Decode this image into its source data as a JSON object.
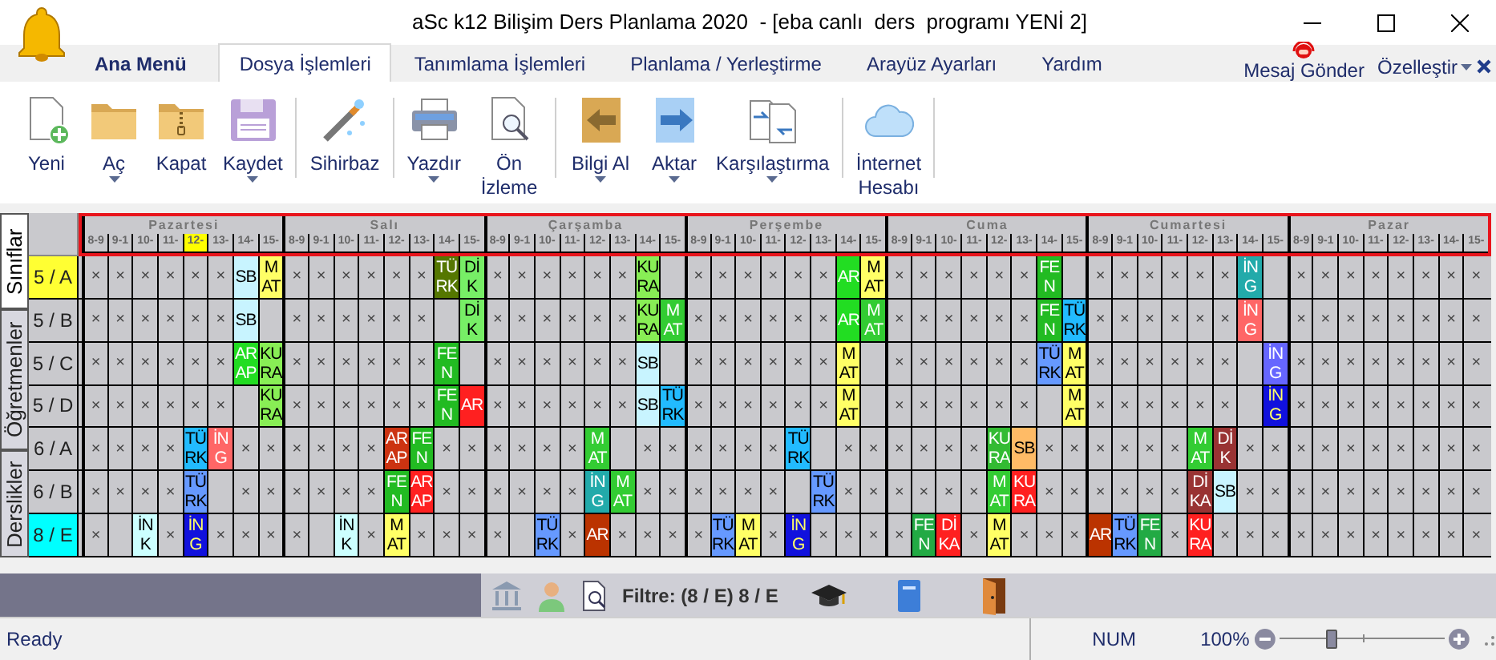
{
  "window": {
    "title": "aSc k12 Bilişim Ders Planlama 2020  - [eba canlı  ders  programı YENİ 2]"
  },
  "ribbon_tabs": [
    {
      "label": "Ana Menü",
      "kind": "app_menu",
      "selected": false
    },
    {
      "label": "Dosya İşlemleri",
      "kind": "tab",
      "selected": true
    },
    {
      "label": "Tanımlama İşlemleri",
      "kind": "tab",
      "selected": false
    },
    {
      "label": "Planlama / Yerleştirme",
      "kind": "tab",
      "selected": false
    },
    {
      "label": "Arayüz Ayarları",
      "kind": "tab",
      "selected": false
    },
    {
      "label": "Yardım",
      "kind": "tab",
      "selected": false
    }
  ],
  "message_button": {
    "label": "Mesaj Gönder"
  },
  "customize_button": {
    "label": "Özelleştir",
    "has_menu": true
  },
  "ribbon_groups": [
    [
      {
        "label": "Yeni",
        "has_menu": false
      },
      {
        "label": "Aç",
        "has_menu": true
      },
      {
        "label": "Kapat",
        "has_menu": false
      },
      {
        "label": "Kaydet",
        "has_menu": true
      }
    ],
    [
      {
        "label": "Sihirbaz",
        "has_menu": false
      }
    ],
    [
      {
        "label": "Yazdır",
        "has_menu": true
      },
      {
        "label": "Ön İzleme",
        "has_menu": false
      }
    ],
    [
      {
        "label": "Bilgi Al",
        "has_menu": true
      },
      {
        "label": "Aktar",
        "has_menu": true
      },
      {
        "label": "Karşılaştırma",
        "has_menu": true
      }
    ],
    [
      {
        "label": "İnternet Hesabı",
        "has_menu": false
      }
    ]
  ],
  "view_tabs": [
    {
      "label": "Sınıflar",
      "selected": true
    },
    {
      "label": "Öğretmenler",
      "selected": false
    },
    {
      "label": "Derslikler",
      "selected": false
    }
  ],
  "timetable": {
    "days": [
      {
        "name": "Pazartesi",
        "hours": [
          {
            "label": "8-9",
            "selected": false
          },
          {
            "label": "9-1",
            "selected": false
          },
          {
            "label": "10-",
            "selected": false
          },
          {
            "label": "11-",
            "selected": false
          },
          {
            "label": "12-",
            "selected": true
          },
          {
            "label": "13-",
            "selected": false
          },
          {
            "label": "14-",
            "selected": false
          },
          {
            "label": "15-",
            "selected": false
          }
        ]
      },
      {
        "name": "Salı",
        "hours": [
          {
            "label": "8-9",
            "selected": false
          },
          {
            "label": "9-1",
            "selected": false
          },
          {
            "label": "10-",
            "selected": false
          },
          {
            "label": "11-",
            "selected": false
          },
          {
            "label": "12-",
            "selected": false
          },
          {
            "label": "13-",
            "selected": false
          },
          {
            "label": "14-",
            "selected": false
          },
          {
            "label": "15-",
            "selected": false
          }
        ]
      },
      {
        "name": "Çarşamba",
        "hours": [
          {
            "label": "8-9",
            "selected": false
          },
          {
            "label": "9-1",
            "selected": false
          },
          {
            "label": "10-",
            "selected": false
          },
          {
            "label": "11-",
            "selected": false
          },
          {
            "label": "12-",
            "selected": false
          },
          {
            "label": "13-",
            "selected": false
          },
          {
            "label": "14-",
            "selected": false
          },
          {
            "label": "15-",
            "selected": false
          }
        ]
      },
      {
        "name": "Perşembe",
        "hours": [
          {
            "label": "8-9",
            "selected": false
          },
          {
            "label": "9-1",
            "selected": false
          },
          {
            "label": "10-",
            "selected": false
          },
          {
            "label": "11-",
            "selected": false
          },
          {
            "label": "12-",
            "selected": false
          },
          {
            "label": "13-",
            "selected": false
          },
          {
            "label": "14-",
            "selected": false
          },
          {
            "label": "15-",
            "selected": false
          }
        ]
      },
      {
        "name": "Cuma",
        "hours": [
          {
            "label": "8-9",
            "selected": false
          },
          {
            "label": "9-1",
            "selected": false
          },
          {
            "label": "10-",
            "selected": false
          },
          {
            "label": "11-",
            "selected": false
          },
          {
            "label": "12-",
            "selected": false
          },
          {
            "label": "13-",
            "selected": false
          },
          {
            "label": "14-",
            "selected": false
          },
          {
            "label": "15-",
            "selected": false
          }
        ]
      },
      {
        "name": "Cumartesi",
        "hours": [
          {
            "label": "8-9",
            "selected": false
          },
          {
            "label": "9-1",
            "selected": false
          },
          {
            "label": "10-",
            "selected": false
          },
          {
            "label": "11-",
            "selected": false
          },
          {
            "label": "12-",
            "selected": false
          },
          {
            "label": "13-",
            "selected": false
          },
          {
            "label": "14-",
            "selected": false
          },
          {
            "label": "15-",
            "selected": false
          }
        ]
      },
      {
        "name": "Pazar",
        "hours": [
          {
            "label": "8-9",
            "selected": false
          },
          {
            "label": "9-1",
            "selected": false
          },
          {
            "label": "10-",
            "selected": false
          },
          {
            "label": "11-",
            "selected": false
          },
          {
            "label": "12-",
            "selected": false
          },
          {
            "label": "13-",
            "selected": false
          },
          {
            "label": "14-",
            "selected": false
          },
          {
            "label": "15-",
            "selected": false
          }
        ]
      }
    ],
    "rows": [
      {
        "label": "5 / A",
        "color": "#ffff33",
        "days": [
          [
            "×",
            "×",
            "×",
            "×",
            "×",
            "×",
            {
              "kind": "lesson",
              "text": "SB",
              "color": "#c8f4ff"
            },
            {
              "kind": "lesson",
              "text": "MAT",
              "color": "#ffff66"
            }
          ],
          [
            "×",
            "×",
            "×",
            "×",
            "×",
            "×",
            {
              "kind": "lesson",
              "text": "TÜRK",
              "color": "#557700"
            },
            {
              "kind": "lesson",
              "text": "DİK",
              "color": "#77ee66"
            }
          ],
          [
            "×",
            "×",
            "×",
            "×",
            "×",
            "×",
            {
              "kind": "lesson",
              "text": "KURA",
              "color": "#88ee55"
            },
            {
              "kind": "free"
            }
          ],
          [
            "×",
            "×",
            "×",
            "×",
            "×",
            "×",
            {
              "kind": "lesson",
              "text": "AR",
              "color": "#22dd22"
            },
            {
              "kind": "lesson",
              "text": "MAT",
              "color": "#ffff66"
            }
          ],
          [
            "×",
            "×",
            "×",
            "×",
            "×",
            "×",
            {
              "kind": "lesson",
              "text": "FEN",
              "color": "#22bb22"
            },
            {
              "kind": "free"
            }
          ],
          [
            "×",
            "×",
            "×",
            "×",
            "×",
            "×",
            {
              "kind": "lesson",
              "text": "İNG",
              "color": "#22aaaa"
            },
            {
              "kind": "free"
            }
          ],
          [
            "×",
            "×",
            "×",
            "×",
            "×",
            "×",
            "×",
            "×"
          ]
        ]
      },
      {
        "label": "5 / B",
        "days": [
          [
            "×",
            "×",
            "×",
            "×",
            "×",
            "×",
            {
              "kind": "lesson",
              "text": "SB",
              "color": "#c8f4ff"
            },
            {
              "kind": "free"
            }
          ],
          [
            "×",
            "×",
            "×",
            "×",
            "×",
            "×",
            {
              "kind": "free"
            },
            {
              "kind": "lesson",
              "text": "DİK",
              "color": "#77ee66"
            }
          ],
          [
            "×",
            "×",
            "×",
            "×",
            "×",
            "×",
            {
              "kind": "lesson",
              "text": "KURA",
              "color": "#88ee55"
            },
            {
              "kind": "lesson",
              "text": "MAT",
              "color": "#33cc33"
            }
          ],
          [
            "×",
            "×",
            "×",
            "×",
            "×",
            "×",
            {
              "kind": "lesson",
              "text": "AR",
              "color": "#22dd22"
            },
            {
              "kind": "lesson",
              "text": "MAT",
              "color": "#33cc33"
            }
          ],
          [
            "×",
            "×",
            "×",
            "×",
            "×",
            "×",
            {
              "kind": "lesson",
              "text": "FEN",
              "color": "#22bb22"
            },
            {
              "kind": "lesson",
              "text": "TÜRK",
              "color": "#22bbff"
            }
          ],
          [
            "×",
            "×",
            "×",
            "×",
            "×",
            "×",
            {
              "kind": "lesson",
              "text": "İNG",
              "color": "#ff6666"
            },
            {
              "kind": "free"
            }
          ],
          [
            "×",
            "×",
            "×",
            "×",
            "×",
            "×",
            "×",
            "×"
          ]
        ]
      },
      {
        "label": "5 / C",
        "days": [
          [
            "×",
            "×",
            "×",
            "×",
            "×",
            "×",
            {
              "kind": "lesson",
              "text": "ARAP",
              "color": "#22dd22"
            },
            {
              "kind": "lesson",
              "text": "KURA",
              "color": "#88ee55"
            }
          ],
          [
            "×",
            "×",
            "×",
            "×",
            "×",
            "×",
            {
              "kind": "lesson",
              "text": "FEN",
              "color": "#22bb22"
            },
            {
              "kind": "free"
            }
          ],
          [
            "×",
            "×",
            "×",
            "×",
            "×",
            "×",
            {
              "kind": "lesson",
              "text": "SB",
              "color": "#c8f4ff"
            },
            {
              "kind": "free"
            }
          ],
          [
            "×",
            "×",
            "×",
            "×",
            "×",
            "×",
            {
              "kind": "lesson",
              "text": "MAT",
              "color": "#ffff66"
            },
            {
              "kind": "free"
            }
          ],
          [
            "×",
            "×",
            "×",
            "×",
            "×",
            "×",
            {
              "kind": "lesson",
              "text": "TÜRK",
              "color": "#6699ff"
            },
            {
              "kind": "lesson",
              "text": "MAT",
              "color": "#ffff66"
            }
          ],
          [
            "×",
            "×",
            "×",
            "×",
            "×",
            "×",
            {
              "kind": "free"
            },
            {
              "kind": "lesson",
              "text": "İNG",
              "color": "#6666ff"
            }
          ],
          [
            "×",
            "×",
            "×",
            "×",
            "×",
            "×",
            "×",
            "×"
          ]
        ]
      },
      {
        "label": "5 / D",
        "days": [
          [
            "×",
            "×",
            "×",
            "×",
            "×",
            "×",
            {
              "kind": "free"
            },
            {
              "kind": "lesson",
              "text": "KURA",
              "color": "#88ee55"
            }
          ],
          [
            "×",
            "×",
            "×",
            "×",
            "×",
            "×",
            {
              "kind": "lesson",
              "text": "FEN",
              "color": "#22bb22"
            },
            {
              "kind": "lesson",
              "text": "AR",
              "color": "#ff2020"
            }
          ],
          [
            "×",
            "×",
            "×",
            "×",
            "×",
            "×",
            {
              "kind": "lesson",
              "text": "SB",
              "color": "#c8f4ff"
            },
            {
              "kind": "lesson",
              "text": "TÜRK",
              "color": "#22bbff"
            }
          ],
          [
            "×",
            "×",
            "×",
            "×",
            "×",
            "×",
            {
              "kind": "lesson",
              "text": "MAT",
              "color": "#ffff66"
            },
            {
              "kind": "free"
            }
          ],
          [
            "×",
            "×",
            "×",
            "×",
            "×",
            "×",
            {
              "kind": "free"
            },
            {
              "kind": "lesson",
              "text": "MAT",
              "color": "#ffff66"
            }
          ],
          [
            "×",
            "×",
            "×",
            "×",
            "×",
            "×",
            {
              "kind": "free"
            },
            {
              "kind": "lesson",
              "text": "İNG",
              "color": "#1111dd"
            }
          ],
          [
            "×",
            "×",
            "×",
            "×",
            "×",
            "×",
            "×",
            "×"
          ]
        ]
      },
      {
        "label": "6 / A",
        "days": [
          [
            "×",
            "×",
            "×",
            "×",
            {
              "kind": "lesson",
              "text": "TÜRK",
              "color": "#22bbff"
            },
            {
              "kind": "lesson",
              "text": "İNG",
              "color": "#ff6666"
            },
            "×",
            "×"
          ],
          [
            "×",
            "×",
            "×",
            "×",
            {
              "kind": "lesson",
              "text": "ARAP",
              "color": "#cc3311"
            },
            {
              "kind": "lesson",
              "text": "FEN",
              "color": "#22bb22"
            },
            "×",
            "×"
          ],
          [
            "×",
            "×",
            "×",
            "×",
            {
              "kind": "lesson",
              "text": "MAT",
              "color": "#33cc33"
            },
            {
              "kind": "free"
            },
            "×",
            "×"
          ],
          [
            "×",
            "×",
            "×",
            "×",
            {
              "kind": "lesson",
              "text": "TÜRK",
              "color": "#22bbff"
            },
            {
              "kind": "free"
            },
            "×",
            "×"
          ],
          [
            "×",
            "×",
            "×",
            "×",
            {
              "kind": "lesson",
              "text": "KURA",
              "color": "#33bb33"
            },
            {
              "kind": "lesson",
              "text": "SB",
              "color": "#ffbb66"
            },
            "×",
            "×"
          ],
          [
            "×",
            "×",
            "×",
            "×",
            {
              "kind": "lesson",
              "text": "MAT",
              "color": "#33cc33"
            },
            {
              "kind": "lesson",
              "text": "DİK",
              "color": "#993333"
            },
            "×",
            "×"
          ],
          [
            "×",
            "×",
            "×",
            "×",
            "×",
            "×",
            "×",
            "×"
          ]
        ]
      },
      {
        "label": "6 / B",
        "days": [
          [
            "×",
            "×",
            "×",
            "×",
            {
              "kind": "lesson",
              "text": "TÜRK",
              "color": "#6699ff"
            },
            {
              "kind": "free"
            },
            "×",
            "×"
          ],
          [
            "×",
            "×",
            "×",
            "×",
            {
              "kind": "lesson",
              "text": "FEN",
              "color": "#22bb22"
            },
            {
              "kind": "lesson",
              "text": "ARAP",
              "color": "#ff2020"
            },
            "×",
            "×"
          ],
          [
            "×",
            "×",
            "×",
            "×",
            {
              "kind": "lesson",
              "text": "İNG",
              "color": "#22aaaa"
            },
            {
              "kind": "lesson",
              "text": "MAT",
              "color": "#33cc33"
            },
            "×",
            "×"
          ],
          [
            "×",
            "×",
            "×",
            "×",
            {
              "kind": "free"
            },
            {
              "kind": "lesson",
              "text": "TÜRK",
              "color": "#6699ff"
            },
            "×",
            "×"
          ],
          [
            "×",
            "×",
            "×",
            "×",
            {
              "kind": "lesson",
              "text": "MAT",
              "color": "#33cc33"
            },
            {
              "kind": "lesson",
              "text": "KURA",
              "color": "#ff2020"
            },
            "×",
            "×"
          ],
          [
            "×",
            "×",
            "×",
            "×",
            {
              "kind": "lesson",
              "text": "DİKA",
              "color": "#993333"
            },
            {
              "kind": "lesson",
              "text": "SB",
              "color": "#c8f4ff"
            },
            "×",
            "×"
          ],
          [
            "×",
            "×",
            "×",
            "×",
            "×",
            "×",
            "×",
            "×"
          ]
        ]
      },
      {
        "label": "8 / E",
        "color": "#00ffff",
        "days": [
          [
            "×",
            {
              "kind": "free"
            },
            {
              "kind": "lesson",
              "text": "İNK",
              "color": "#ccffff"
            },
            "×",
            {
              "kind": "lesson",
              "text": "İNG",
              "color": "#1111dd"
            },
            "×",
            "×",
            "×"
          ],
          [
            "×",
            {
              "kind": "free"
            },
            {
              "kind": "lesson",
              "text": "İNK",
              "color": "#ccffff"
            },
            "×",
            {
              "kind": "lesson",
              "text": "MAT",
              "color": "#ffff66"
            },
            "×",
            "×",
            "×"
          ],
          [
            "×",
            {
              "kind": "free"
            },
            {
              "kind": "lesson",
              "text": "TÜRK",
              "color": "#6699ff"
            },
            "×",
            {
              "kind": "lesson",
              "text": "AR",
              "color": "#bb3300"
            },
            "×",
            "×",
            "×"
          ],
          [
            "×",
            {
              "kind": "lesson",
              "text": "TÜRK",
              "color": "#6699ff"
            },
            {
              "kind": "lesson",
              "text": "MAT",
              "color": "#ffff66"
            },
            "×",
            {
              "kind": "lesson",
              "text": "İNG",
              "color": "#1111dd"
            },
            "×",
            "×",
            "×"
          ],
          [
            "×",
            {
              "kind": "lesson",
              "text": "FEN",
              "color": "#22aa44"
            },
            {
              "kind": "lesson",
              "text": "DİKA",
              "color": "#ff2020"
            },
            "×",
            {
              "kind": "lesson",
              "text": "MAT",
              "color": "#ffff66"
            },
            "×",
            "×",
            "×"
          ],
          [
            {
              "kind": "lesson",
              "text": "AR",
              "color": "#bb3300"
            },
            {
              "kind": "lesson",
              "text": "TÜRK",
              "color": "#6699ff"
            },
            {
              "kind": "lesson",
              "text": "FEN",
              "color": "#22aa44"
            },
            "×",
            {
              "kind": "lesson",
              "text": "KURA",
              "color": "#ff2020"
            },
            "×",
            "×",
            "×"
          ],
          [
            "×",
            "×",
            "×",
            "×",
            "×",
            "×",
            "×",
            "×"
          ]
        ]
      }
    ]
  },
  "filter_bar": {
    "text": "Filtre: (8 / E) 8 / E"
  },
  "status_bar": {
    "status": "Ready",
    "num": "NUM",
    "zoom": "100%",
    "zoom_slider": {
      "level": 0.3
    }
  }
}
